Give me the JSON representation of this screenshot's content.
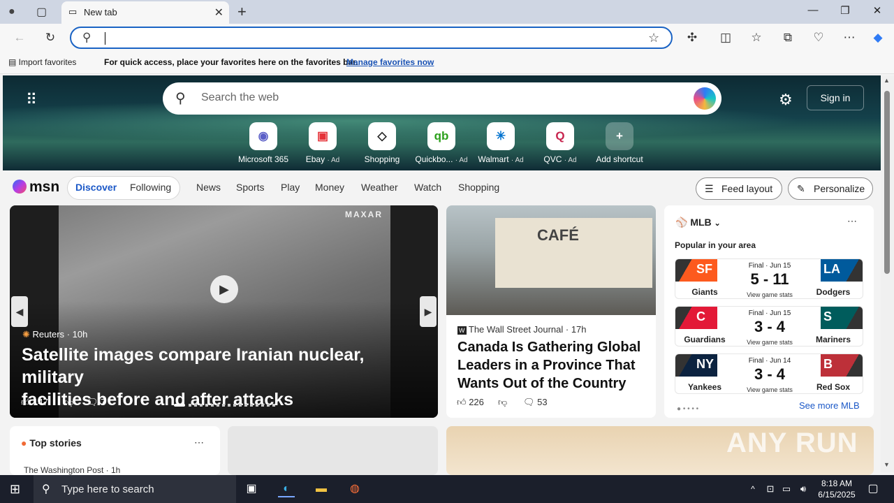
{
  "browser": {
    "tab_title": "New tab",
    "tab_close": "✕",
    "new_tab": "+",
    "window": {
      "minimize": "—",
      "restore": "❐",
      "close": "✕"
    }
  },
  "favorites_bar": {
    "import": "Import favorites",
    "message": "For quick access, place your favorites here on the favorites bar.",
    "manage": "Manage favorites now"
  },
  "hero": {
    "search_placeholder": "Search the web",
    "sign_in": "Sign in",
    "shortcuts": [
      {
        "label": "Microsoft 365",
        "ad": "",
        "glyph": "◉",
        "color": "#5b5fc7"
      },
      {
        "label": "Ebay",
        "ad": "· Ad",
        "glyph": "▣",
        "color": "#e53238"
      },
      {
        "label": "Shopping",
        "ad": "",
        "glyph": "◇",
        "color": "#222222"
      },
      {
        "label": "Quickbo...",
        "ad": "· Ad",
        "glyph": "qb",
        "color": "#2ca01c"
      },
      {
        "label": "Walmart",
        "ad": "· Ad",
        "glyph": "✳",
        "color": "#0071ce"
      },
      {
        "label": "QVC",
        "ad": "· Ad",
        "glyph": "Q",
        "color": "#c7254e"
      },
      {
        "label": "Add shortcut",
        "ad": "",
        "glyph": "+",
        "color": "#333333"
      }
    ]
  },
  "msn_nav": {
    "logo": "msn",
    "items": [
      "Discover",
      "Following",
      "News",
      "Sports",
      "Play",
      "Money",
      "Weather",
      "Watch",
      "Shopping"
    ],
    "feed_layout": "Feed layout",
    "personalize": "Personalize"
  },
  "main_story": {
    "source": "Reuters",
    "age": "· 10h",
    "headline_line1": "Satellite images compare Iranian nuclear, military",
    "headline_line2": "facilities before and after attacks",
    "likes": "147",
    "comments": "7",
    "watermark": "MAXAR"
  },
  "wsj_story": {
    "source": "The Wall Street Journal",
    "age": "· 17h",
    "headline_line1": "Canada Is Gathering Global",
    "headline_line2": "Leaders in a Province That",
    "headline_line3": "Wants Out of the Country",
    "likes": "226",
    "comments": "53",
    "sign": "CAFÉ"
  },
  "mlb": {
    "title": "MLB",
    "subtitle": "Popular in your area",
    "see_more": "See more MLB",
    "games": [
      {
        "status": "Final · Jun 15",
        "score": "5 - 11",
        "home": "Giants",
        "away": "Dodgers",
        "stats": "View game stats",
        "hl": "SF",
        "hc": "#fd5a1e",
        "al": "LA",
        "ac": "#005a9c"
      },
      {
        "status": "Final · Jun 15",
        "score": "3 - 4",
        "home": "Guardians",
        "away": "Mariners",
        "stats": "View game stats",
        "hl": "C",
        "hc": "#e31937",
        "al": "S",
        "ac": "#005c5c"
      },
      {
        "status": "Final · Jun 14",
        "score": "3 - 4",
        "home": "Yankees",
        "away": "Red Sox",
        "stats": "View game stats",
        "hl": "NY",
        "hc": "#0c2340",
        "al": "B",
        "ac": "#bd3039"
      }
    ]
  },
  "top_stories": {
    "title": "Top stories",
    "source": "The Washington Post · 1h"
  },
  "taskbar": {
    "search": "Type here to search",
    "time": "8:18 AM",
    "date": "6/15/2025"
  },
  "watermark": "ANY RUN"
}
